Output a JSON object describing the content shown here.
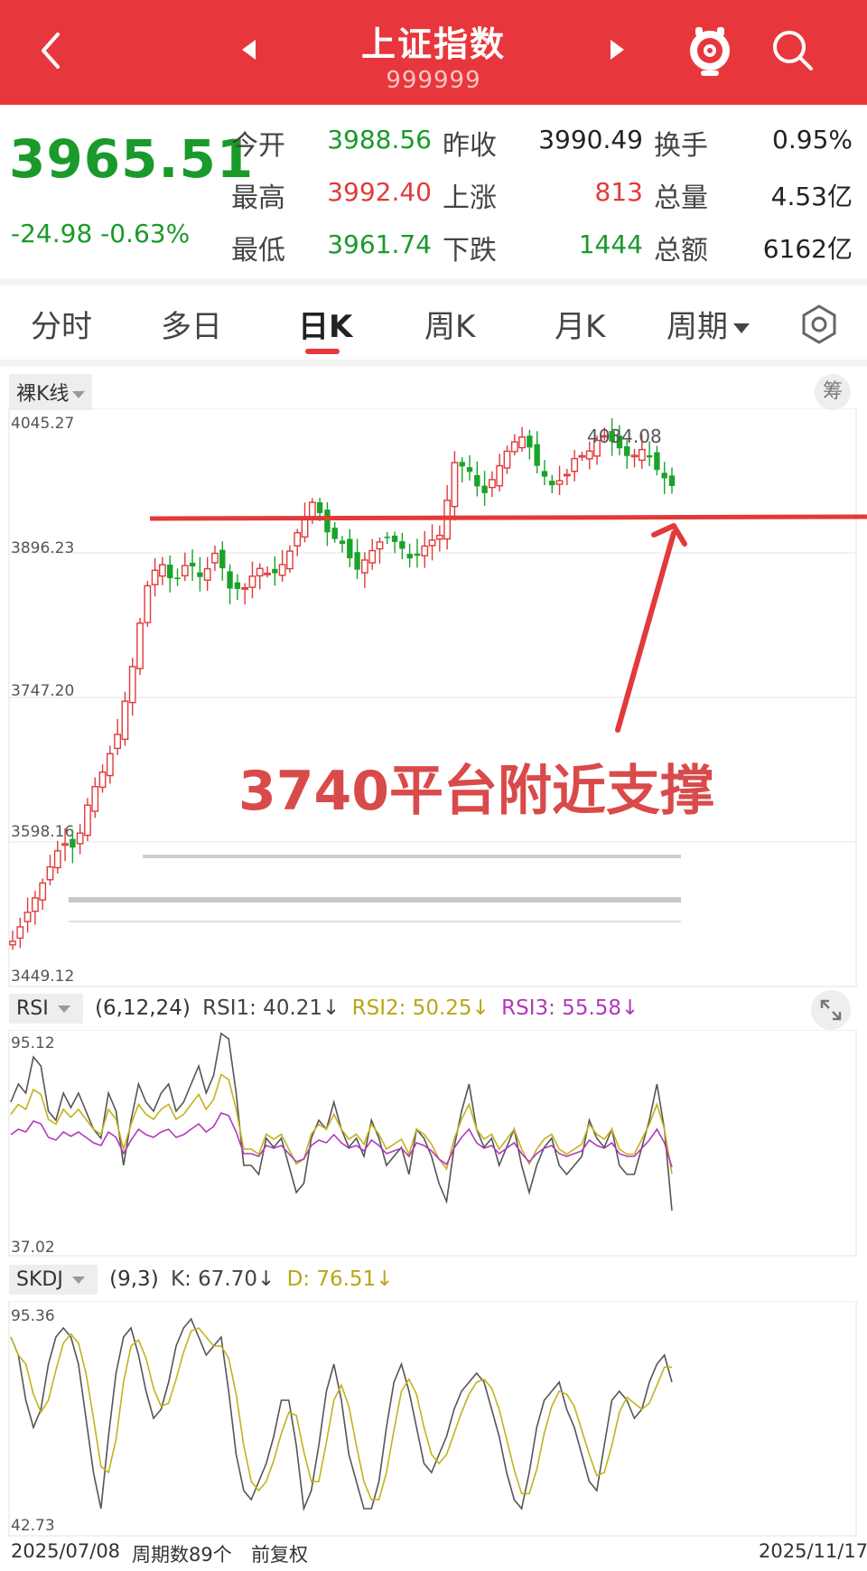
{
  "header": {
    "title": "上证指数",
    "code": "999999"
  },
  "quote": {
    "price": "3965.51",
    "change": "-24.98 -0.63%",
    "fields": [
      {
        "label": "今开",
        "value": "3988.56",
        "color": "green"
      },
      {
        "label": "昨收",
        "value": "3990.49",
        "color": "black"
      },
      {
        "label": "换手",
        "value": "0.95%",
        "color": "black"
      },
      {
        "label": "最高",
        "value": "3992.40",
        "color": "red"
      },
      {
        "label": "上涨",
        "value": "813",
        "color": "red"
      },
      {
        "label": "总量",
        "value": "4.53亿",
        "color": "black"
      },
      {
        "label": "最低",
        "value": "3961.74",
        "color": "green"
      },
      {
        "label": "下跌",
        "value": "1444",
        "color": "green"
      },
      {
        "label": "总额",
        "value": "6162亿",
        "color": "black"
      }
    ]
  },
  "tabs": [
    {
      "label": "分时"
    },
    {
      "label": "多日"
    },
    {
      "label": "日K",
      "active": true
    },
    {
      "label": "周K"
    },
    {
      "label": "月K"
    },
    {
      "label": "周期"
    }
  ],
  "kline": {
    "mode_label": "裸K线",
    "chip_label": "筹",
    "y_ticks": [
      "4045.27",
      "3896.23",
      "3747.20",
      "3598.16",
      "3449.12"
    ],
    "high_label": "4034.08",
    "annotation": "3740平台附近支撑",
    "colors": {
      "up": "#e03a3a",
      "down": "#1aa32a",
      "annotation": "#e23a3a"
    }
  },
  "rsi": {
    "name": "RSI",
    "params": "(6,12,24)",
    "rsi1": "RSI1: 40.21↓",
    "rsi2": "RSI2: 50.25↓",
    "rsi3": "RSI3: 55.58↓",
    "y_top": "95.12",
    "y_bottom": "37.02"
  },
  "kdj": {
    "name": "SKDJ",
    "params": "(9,3)",
    "k": "K: 67.70↓",
    "d": "D: 76.51↓",
    "y_top": "95.36",
    "y_bottom": "42.73"
  },
  "footer": {
    "start_date": "2025/07/08",
    "period_count": "周期数89个",
    "adjust": "前复权",
    "end_date": "2025/11/17"
  }
}
